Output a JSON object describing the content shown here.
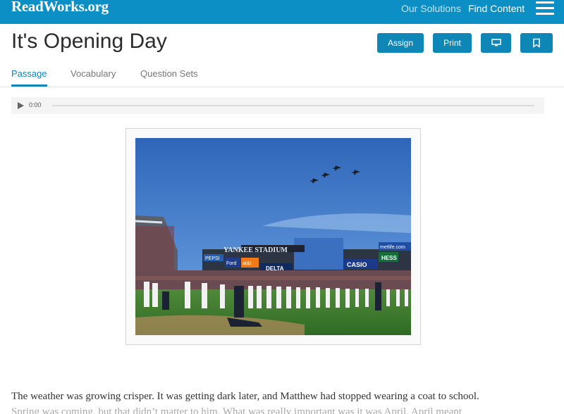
{
  "header": {
    "logo": "ReadWorks.org",
    "nav": [
      "Our Solutions",
      "Find Content"
    ]
  },
  "title": "It's Opening Day",
  "actions": {
    "assign": "Assign",
    "print": "Print"
  },
  "tabs": [
    "Passage",
    "Vocabulary",
    "Question Sets"
  ],
  "audio": {
    "time": "0:00",
    "progress": 0
  },
  "image": {
    "stadium_sign": "YANKEE STADIUM",
    "ads": [
      "PEPSI",
      "Ford",
      "at&t",
      "DELTA",
      "CASIO",
      "HESS",
      "metlife.com"
    ]
  },
  "passage": {
    "line1": "The weather was growing crisper. It was getting dark later, and Matthew had stopped wearing a coat to school.",
    "line2": "Spring was coming, but that didn’t matter to him. What was really important was it was April. April meant"
  },
  "colors": {
    "brand": "#0b8fc4",
    "button": "#0e86b6"
  },
  "icons": [
    "hamburger-menu-icon",
    "monitor-icon",
    "bookmark-icon",
    "play-icon"
  ]
}
